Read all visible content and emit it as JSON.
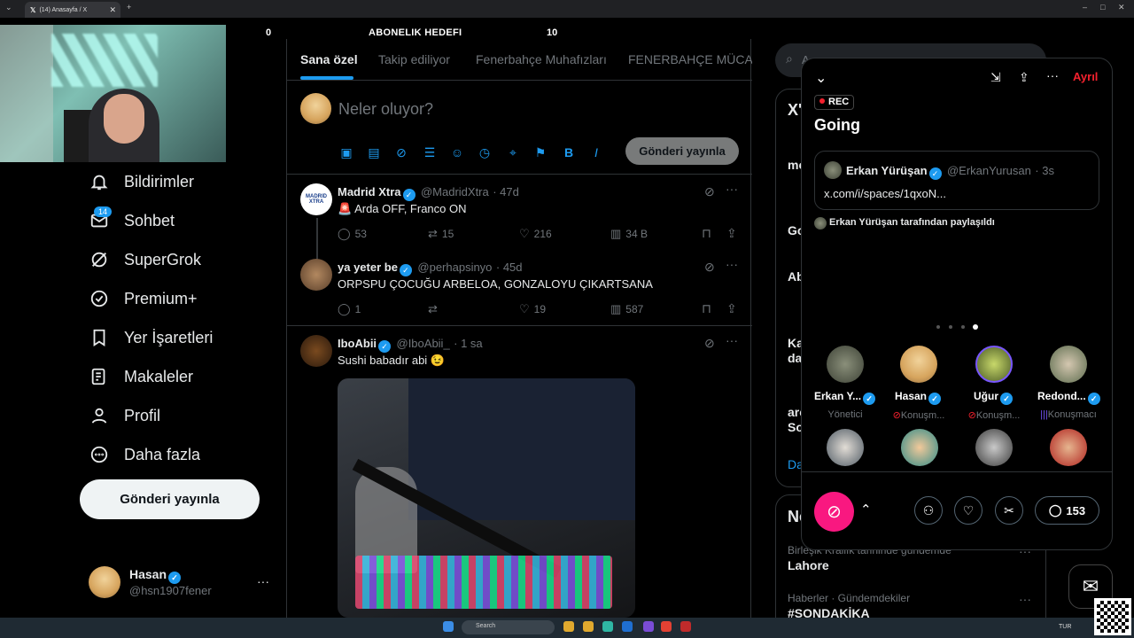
{
  "browser": {
    "tab_title": "(14) Anasayfa / X",
    "tab_icon": "x-logo-icon",
    "new_tab": "+",
    "close": "✕"
  },
  "stream_overlay": {
    "left_count": "0",
    "goal_label": "ABONELIK HEDEFI",
    "goal_count": "10"
  },
  "nav": {
    "items": [
      {
        "label": "Bildirimler",
        "icon": "bell-icon"
      },
      {
        "label": "Sohbet",
        "icon": "envelope-icon",
        "badge": "14"
      },
      {
        "label": "SuperGrok",
        "icon": "grok-icon"
      },
      {
        "label": "Premium+",
        "icon": "verified-badge-icon"
      },
      {
        "label": "Yer İşaretleri",
        "icon": "bookmark-icon"
      },
      {
        "label": "Makaleler",
        "icon": "article-icon"
      },
      {
        "label": "Profil",
        "icon": "person-icon"
      },
      {
        "label": "Daha fazla",
        "icon": "more-circle-icon"
      }
    ],
    "post_button": "Gönderi yayınla",
    "account": {
      "name": "Hasan",
      "handle": "@hsn1907fener",
      "more": "···"
    }
  },
  "feed": {
    "tabs": [
      "Sana özel",
      "Takip ediliyor",
      "Fenerbahçe Muhafızları",
      "FENERBAHÇE MÜCADİ"
    ],
    "active_tab": 0,
    "compose": {
      "placeholder": "Neler oluyor?",
      "button": "Gönderi yayınla"
    },
    "tweets": [
      {
        "name": "Madrid Xtra",
        "handle": "@MadridXtra",
        "time": "· 47d",
        "text": "🚨 Arda OFF, Franco ON",
        "replies": "53",
        "retweets": "15",
        "likes": "216",
        "views": "34 B",
        "avatar_text": "MADRID XTRA"
      },
      {
        "name": "ya yeter be",
        "handle": "@perhapsinyo",
        "time": "· 45d",
        "text": "ORPSPU ÇOCUĞU ARBELOA, GONZALOYU ÇIKARTSANA",
        "replies": "1",
        "retweets": "",
        "likes": "19",
        "views": "587"
      },
      {
        "name": "IboAbii",
        "handle": "@IboAbii_",
        "time": "· 1 sa",
        "text": "Sushi babadır abi 😉"
      }
    ]
  },
  "right": {
    "search_placeholder": "A",
    "trends": [
      {
        "meta": "",
        "title": "X'"
      },
      {
        "meta": "",
        "title": "mo"
      },
      {
        "meta": "",
        "title": "Go"
      },
      {
        "meta": "",
        "title": "Ab"
      },
      {
        "meta": "",
        "title": "Ka"
      },
      {
        "meta": "",
        "title": "da"
      },
      {
        "meta": "",
        "title": "arc"
      },
      {
        "meta": "",
        "title": "So"
      },
      {
        "meta": "",
        "title": "Da"
      }
    ],
    "news_header": "Ne",
    "news": [
      {
        "meta": "Birleşik Krallık tarihinde gündemde",
        "title": "Lahore"
      },
      {
        "meta": "Haberler · Gündemdekiler",
        "title": "#SONDAKİKA"
      }
    ]
  },
  "space": {
    "leave": "Ayrıl",
    "rec": "REC",
    "title": "Going",
    "shared_post": {
      "name": "Erkan Yürüşan",
      "handle": "@ErkanYurusan",
      "time": "· 3s",
      "text": "x.com/i/spaces/1qxoN..."
    },
    "shared_by": "Erkan Yürüşan tarafından paylaşıldı",
    "hosts": [
      {
        "name": "Erkan Y...",
        "role": "Yönetici"
      },
      {
        "name": "Hasan",
        "role": "Konuşm..."
      },
      {
        "name": "Uğur",
        "role": "Konuşm..."
      },
      {
        "name": "Redond...",
        "role": "Konuşmacı"
      }
    ],
    "chat_count": "153"
  },
  "taskbar": {
    "search": "Search",
    "lang": "TUR"
  },
  "colors": {
    "accent": "#1d9bf0",
    "danger": "#f4212e",
    "mic": "#f91880"
  }
}
